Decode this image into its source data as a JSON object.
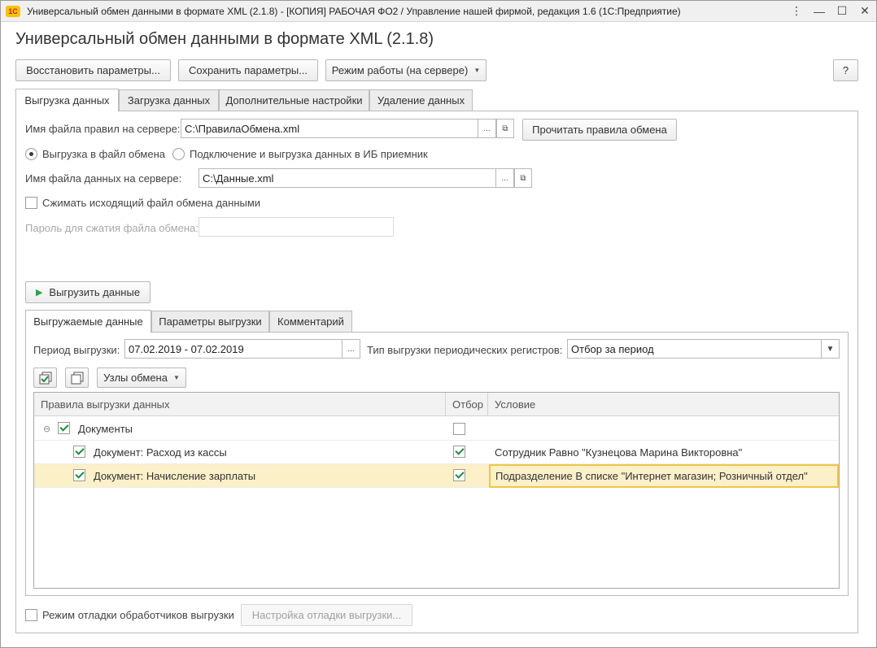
{
  "window": {
    "title": "Универсальный обмен данными в формате XML (2.1.8) - [КОПИЯ] РАБОЧАЯ ФО2 / Управление нашей фирмой, редакция 1.6  (1С:Предприятие)",
    "logo_text": "1С",
    "controls": [
      "⋮",
      "—",
      "☐",
      "✕"
    ]
  },
  "heading": "Универсальный обмен данными в формате XML (2.1.8)",
  "toolbar": {
    "restore": "Восстановить параметры...",
    "save": "Сохранить параметры...",
    "mode": "Режим работы (на сервере)",
    "help": "?"
  },
  "tabs": [
    "Выгрузка данных",
    "Загрузка данных",
    "Дополнительные настройки",
    "Удаление данных"
  ],
  "export": {
    "rules_label": "Имя файла правил на сервере:",
    "rules_value": "C:\\ПравилаОбмена.xml",
    "read_rules": "Прочитать правила обмена",
    "radio_file": "Выгрузка в файл обмена",
    "radio_connect": "Подключение и выгрузка данных в ИБ приемник",
    "data_label": "Имя файла данных на сервере:",
    "data_value": "C:\\Данные.xml",
    "compress": "Сжимать исходящий файл обмена данными",
    "password_label": "Пароль для сжатия файла обмена:",
    "run": "Выгрузить данные"
  },
  "subtabs": [
    "Выгружаемые данные",
    "Параметры выгрузки",
    "Комментарий"
  ],
  "period_label": "Период выгрузки:",
  "period_value": "07.02.2019 - 07.02.2019",
  "reg_label": "Тип выгрузки периодических регистров:",
  "reg_value": "Отбор за период",
  "nodes_button": "Узлы обмена",
  "table": {
    "headers": [
      "Правила выгрузки данных",
      "Отбор",
      "Условие"
    ],
    "rows": [
      {
        "name": "Документы",
        "filter": false,
        "condition": ""
      },
      {
        "name": "Документ: Расход из кассы",
        "filter": true,
        "condition": "Сотрудник Равно \"Кузнецова Марина Викторовна\""
      },
      {
        "name": "Документ: Начисление зарплаты",
        "filter": true,
        "condition": "Подразделение В списке \"Интернет магазин; Розничный отдел\""
      }
    ]
  },
  "debug": {
    "checkbox_label": "Режим отладки обработчиков выгрузки",
    "settings_button": "Настройка отладки выгрузки..."
  },
  "colors": {
    "accent_check": "#1f8a3c",
    "selected_row": "#fbf0c8",
    "active_cell_border": "#efc64b"
  }
}
